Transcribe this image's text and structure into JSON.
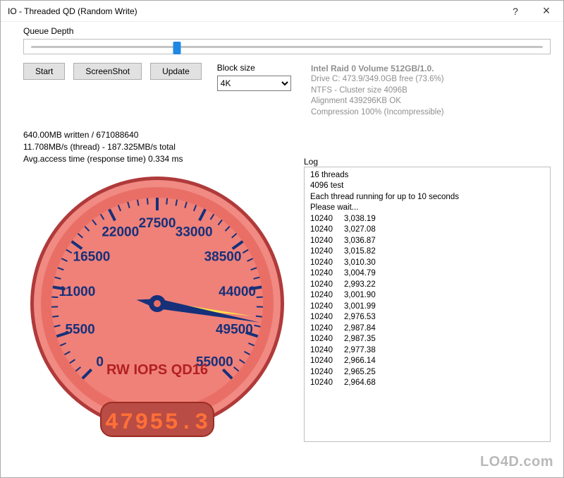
{
  "window": {
    "title": "IO - Threaded QD (Random Write)",
    "help": "?",
    "close": "×"
  },
  "slider": {
    "label": "Queue Depth"
  },
  "toolbar": {
    "start": "Start",
    "screenshot": "ScreenShot",
    "update": "Update"
  },
  "block_size": {
    "label": "Block size",
    "value": "4K"
  },
  "drive": {
    "name": "Intel Raid 0 Volume 512GB/1.0.",
    "free": "Drive C: 473.9/349.0GB free (73.6%)",
    "fs": "NTFS - Cluster size 4096B",
    "align": "Alignment 439296KB OK",
    "comp": "Compression 100% (Incompressible)"
  },
  "stats": {
    "line1": "640.00MB written / 671088640",
    "line2": "11.708MB/s (thread) - 187.325MB/s total",
    "line3": "Avg.access time (response time) 0.334 ms"
  },
  "gauge": {
    "label": "RW IOPS QD16",
    "digital": "47955.3",
    "ticks": [
      "0",
      "5500",
      "11000",
      "16500",
      "22000",
      "27500",
      "33000",
      "38500",
      "44000",
      "49500",
      "55000"
    ]
  },
  "log": {
    "label": "Log",
    "header": [
      "16 threads",
      "4096 test",
      "Each thread running for up to 10 seconds",
      "Please wait..."
    ],
    "rows": [
      [
        "10240",
        "3,038.19"
      ],
      [
        "10240",
        "3,027.08"
      ],
      [
        "10240",
        "3,036.87"
      ],
      [
        "10240",
        "3,015.82"
      ],
      [
        "10240",
        "3,010.30"
      ],
      [
        "10240",
        "3,004.79"
      ],
      [
        "10240",
        "2,993.22"
      ],
      [
        "10240",
        "3,001.90"
      ],
      [
        "10240",
        "3,001.99"
      ],
      [
        "10240",
        "2,976.53"
      ],
      [
        "10240",
        "2,987.84"
      ],
      [
        "10240",
        "2,987.35"
      ],
      [
        "10240",
        "2,977.38"
      ],
      [
        "10240",
        "2,966.14"
      ],
      [
        "10240",
        "2,965.25"
      ],
      [
        "10240",
        "2,964.68"
      ]
    ]
  },
  "watermark": "LO4D.com",
  "chart_data": {
    "type": "gauge",
    "title": "RW IOPS QD16",
    "min": 0,
    "max": 55000,
    "value": 47955.3,
    "ticks_major": [
      0,
      5500,
      11000,
      16500,
      22000,
      27500,
      33000,
      38500,
      44000,
      49500,
      55000
    ],
    "unit": "IOPS",
    "pointer_angle_deg_from_min": 235.3,
    "sweep_deg": 270
  }
}
